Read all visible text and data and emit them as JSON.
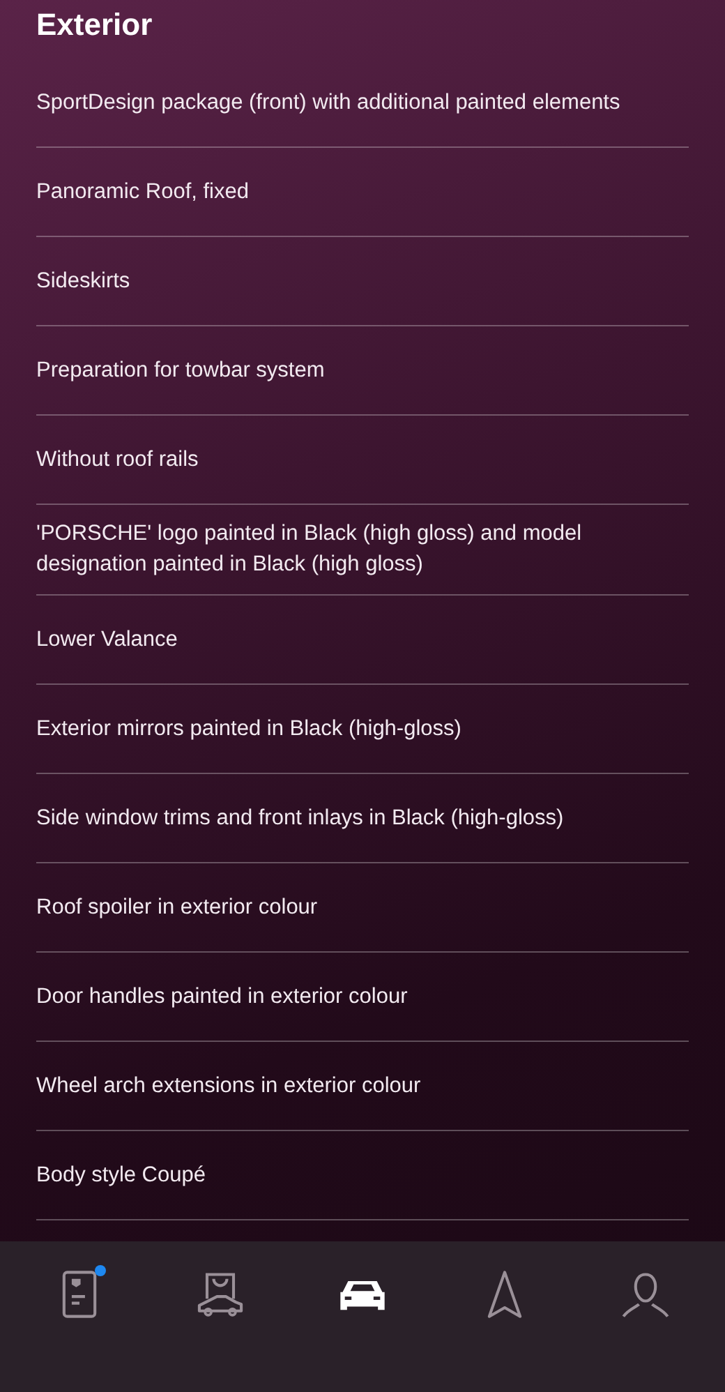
{
  "header": {
    "title": "Exterior"
  },
  "items": [
    {
      "label": "SportDesign package (front) with additional painted elements"
    },
    {
      "label": "Panoramic Roof, fixed"
    },
    {
      "label": "Sideskirts"
    },
    {
      "label": "Preparation for towbar system"
    },
    {
      "label": "Without roof rails"
    },
    {
      "label": "'PORSCHE' logo painted in Black (high gloss) and model designation painted in Black (high gloss)"
    },
    {
      "label": "Lower Valance"
    },
    {
      "label": "Exterior mirrors painted in Black (high-gloss)"
    },
    {
      "label": "Side window trims and front inlays in Black (high-gloss)"
    },
    {
      "label": "Roof spoiler in exterior colour"
    },
    {
      "label": "Door handles painted in exterior colour"
    },
    {
      "label": "Wheel arch extensions in exterior colour"
    },
    {
      "label": "Body style Coupé"
    }
  ],
  "nav": [
    {
      "kind": "card",
      "selected": false,
      "badge": true
    },
    {
      "kind": "shop",
      "selected": false,
      "badge": false
    },
    {
      "kind": "car",
      "selected": true,
      "badge": false
    },
    {
      "kind": "navigate",
      "selected": false,
      "badge": false
    },
    {
      "kind": "profile",
      "selected": false,
      "badge": false
    }
  ]
}
